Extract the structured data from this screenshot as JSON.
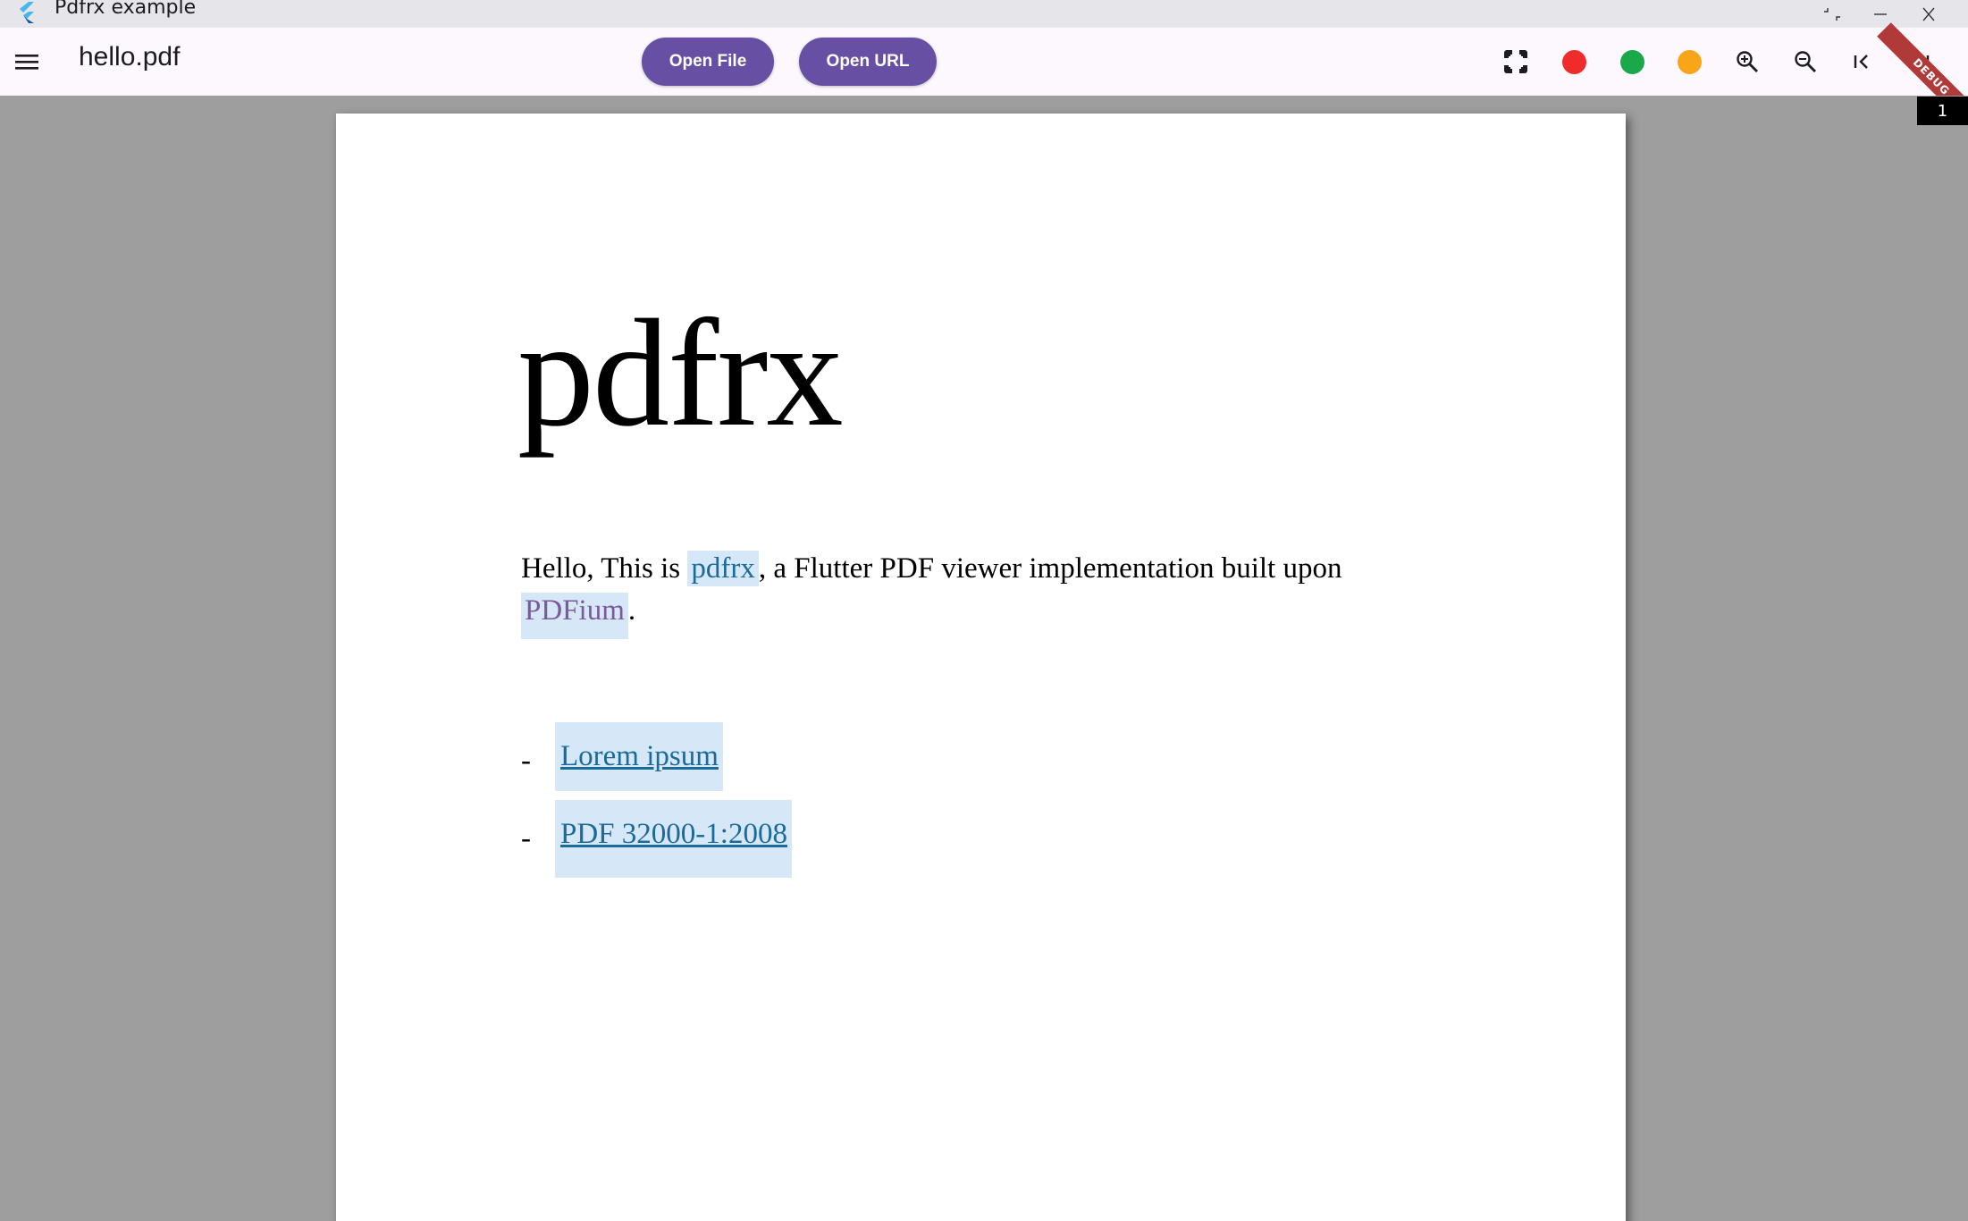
{
  "window": {
    "title": "Pdfrx example"
  },
  "appbar": {
    "document_title": "hello.pdf",
    "open_file_label": "Open File",
    "open_url_label": "Open URL",
    "tools": [
      {
        "name": "fit-page-icon"
      },
      {
        "name": "red-marker",
        "color": "#f02b2b"
      },
      {
        "name": "green-marker",
        "color": "#1aa84a"
      },
      {
        "name": "orange-marker",
        "color": "#f9a51a"
      },
      {
        "name": "zoom-in-icon"
      },
      {
        "name": "zoom-out-icon"
      },
      {
        "name": "first-page-icon"
      },
      {
        "name": "last-page-icon"
      }
    ],
    "debug_banner": "DEBUG"
  },
  "viewer": {
    "page_number": "1"
  },
  "pdf": {
    "heading": "pdfrx",
    "para_prefix": "Hello, This is ",
    "para_link1": "pdfrx",
    "para_middle": ", a Flutter PDF viewer implementation built upon",
    "para_link2": "PDFium",
    "para_suffix": ".",
    "list": [
      {
        "bullet": "-",
        "text": "Lorem ipsum"
      },
      {
        "bullet": "-",
        "text": "PDF 32000-1:2008"
      }
    ]
  },
  "colors": {
    "accent": "#6750a4",
    "appbar_bg": "#fdf7fe",
    "viewer_bg": "#9e9e9e",
    "highlight": "#d6e8f8"
  }
}
